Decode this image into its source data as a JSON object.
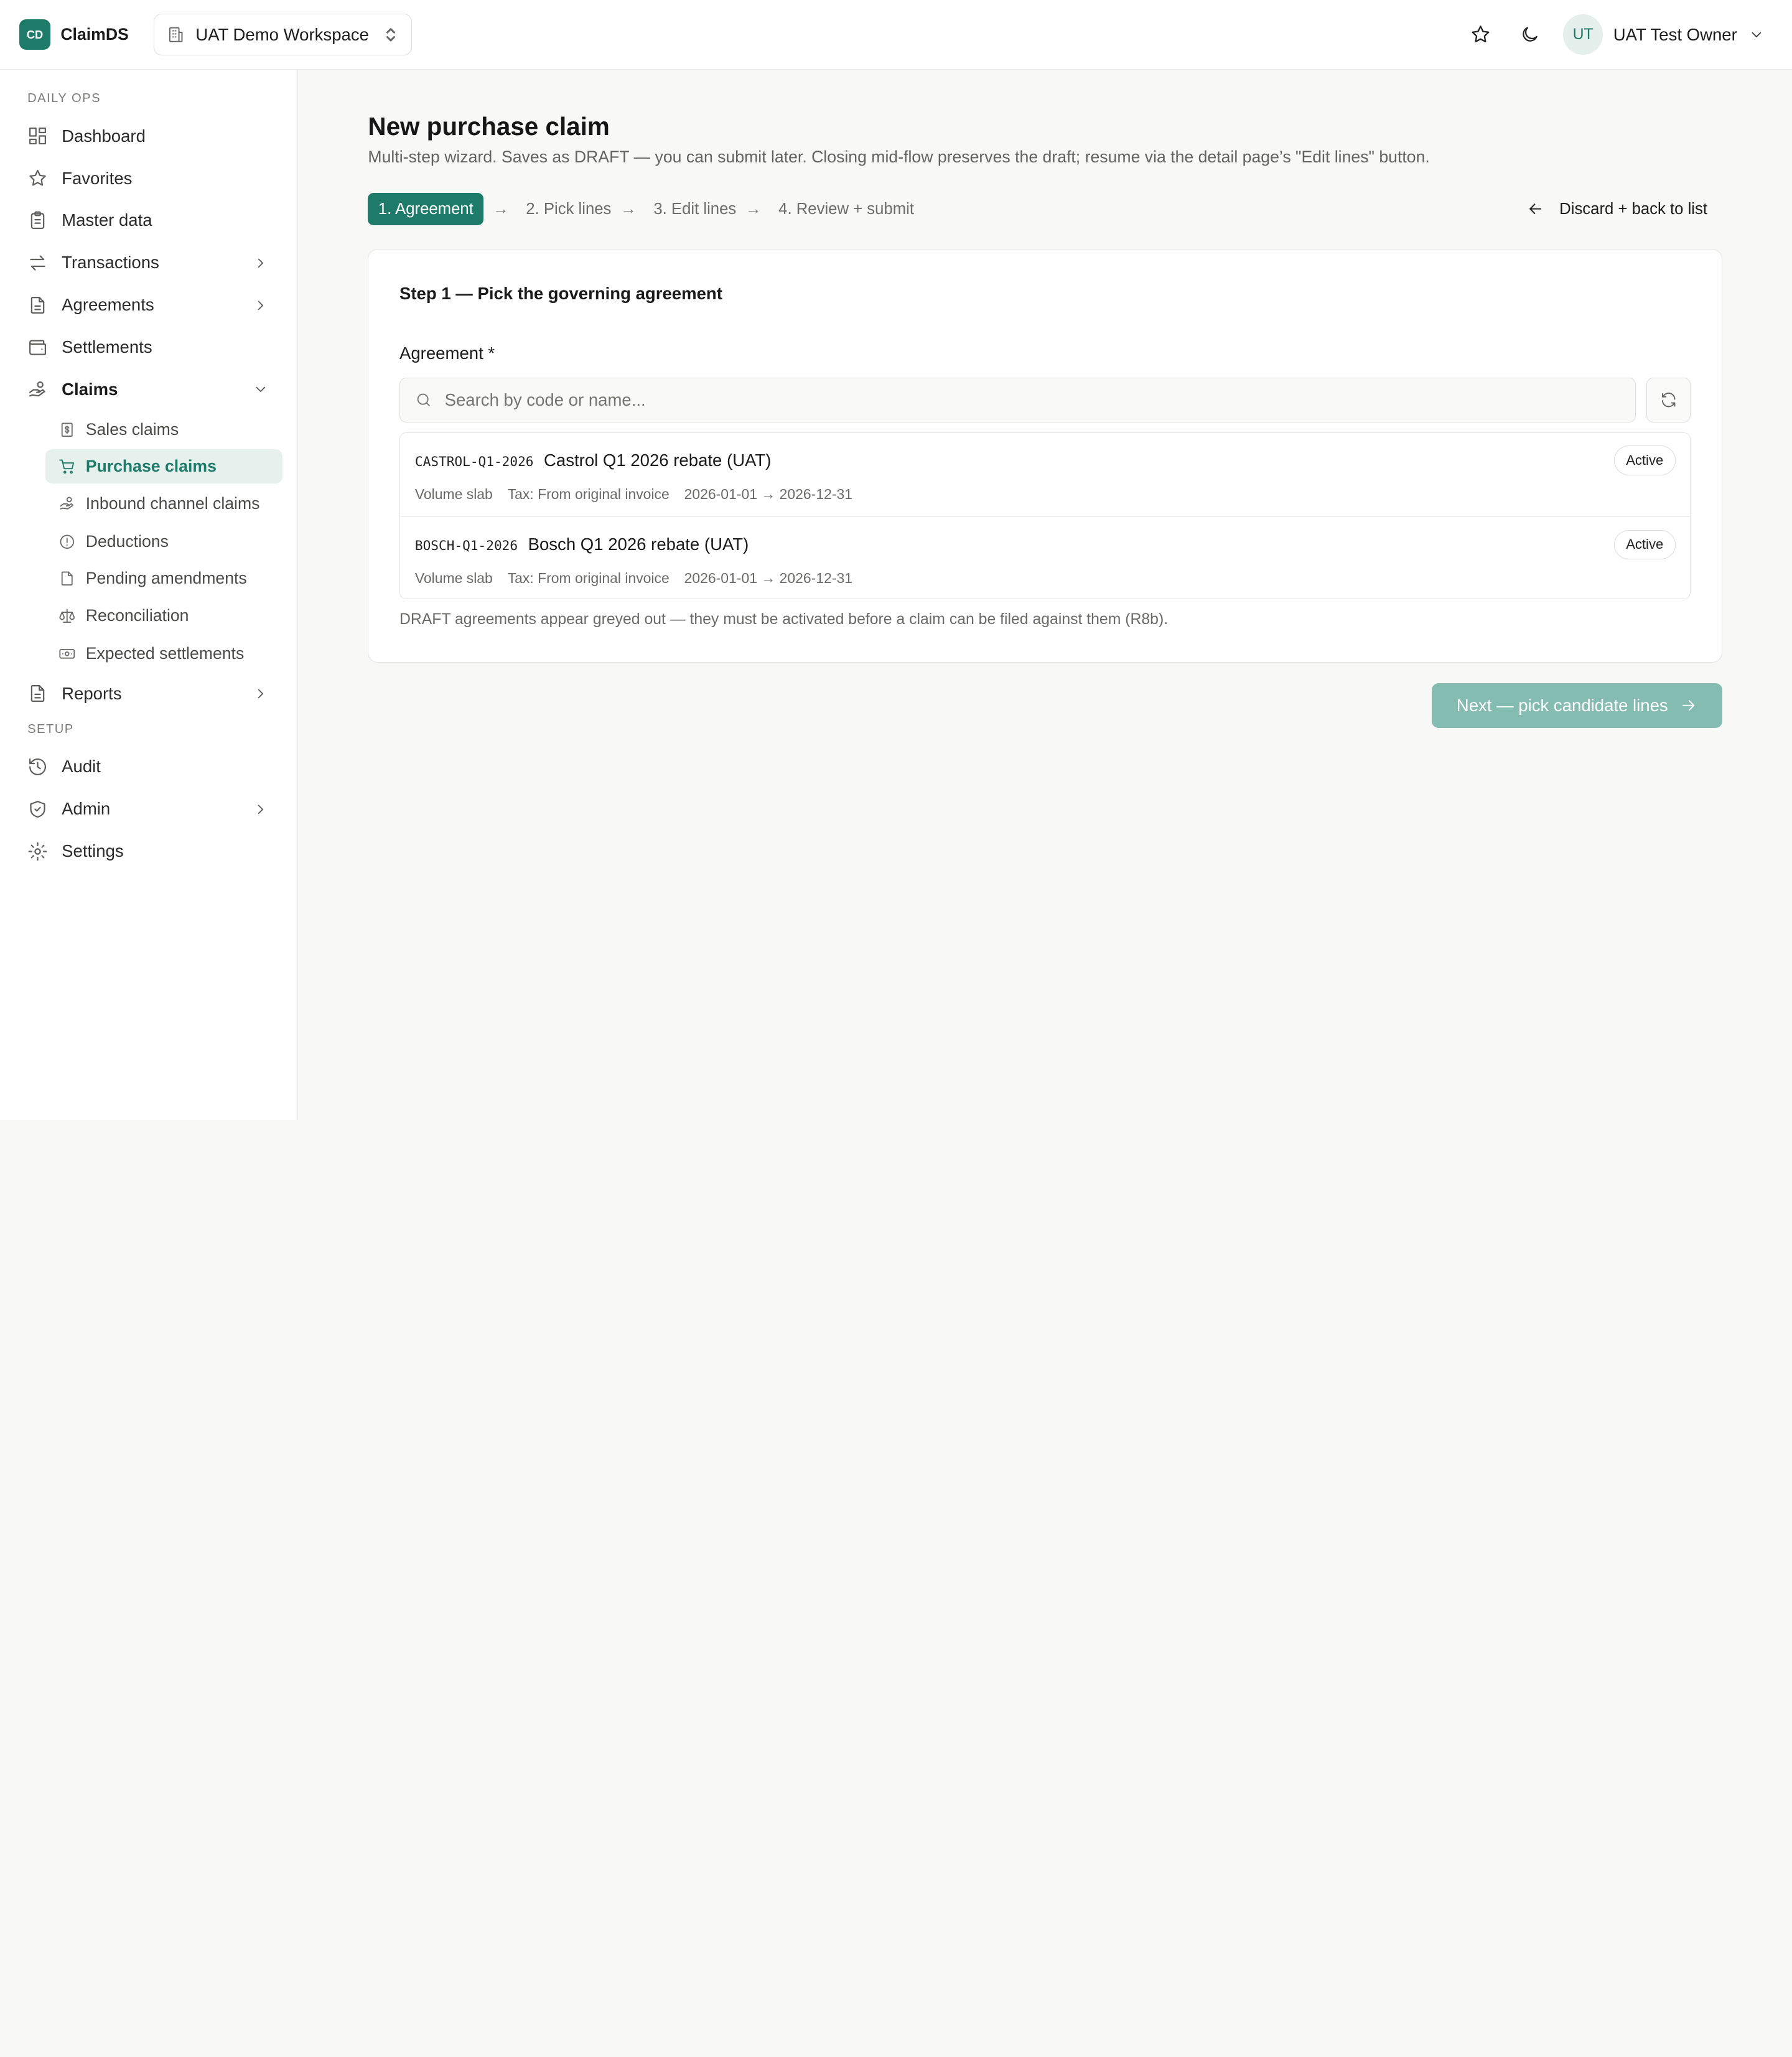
{
  "app": {
    "logo_initials": "CD",
    "name": "ClaimDS"
  },
  "workspace": {
    "name": "UAT Demo Workspace"
  },
  "user": {
    "initials": "UT",
    "name": "UAT Test Owner"
  },
  "sidebar": {
    "section_daily": "DAILY OPS",
    "section_setup": "SETUP",
    "items": {
      "dashboard": "Dashboard",
      "favorites": "Favorites",
      "master_data": "Master data",
      "transactions": "Transactions",
      "agreements": "Agreements",
      "settlements": "Settlements",
      "claims": "Claims",
      "reports": "Reports",
      "audit": "Audit",
      "admin": "Admin",
      "settings": "Settings"
    },
    "claims_sub": {
      "sales_claims": "Sales claims",
      "purchase_claims": "Purchase claims",
      "inbound_channel_claims": "Inbound channel claims",
      "deductions": "Deductions",
      "pending_amendments": "Pending amendments",
      "reconciliation": "Reconciliation",
      "expected_settlements": "Expected settlements"
    },
    "active_item": "Purchase claims"
  },
  "page": {
    "title": "New purchase claim",
    "subtitle": "Multi-step wizard. Saves as DRAFT — you can submit later. Closing mid-flow preserves the draft; resume via the detail page’s \"Edit lines\" button.",
    "discard_label": "Discard + back to list"
  },
  "wizard": {
    "steps": [
      "1. Agreement",
      "2. Pick lines",
      "3. Edit lines",
      "4. Review + submit"
    ],
    "arrow": "→",
    "current_step": 1
  },
  "step1": {
    "title": "Step 1 — Pick the governing agreement",
    "field_label": "Agreement *",
    "search_placeholder": "Search by code or name...",
    "search_value": "",
    "agreements": [
      {
        "code": "CASTROL-Q1-2026",
        "name": "Castrol Q1 2026 rebate (UAT)",
        "type": "Volume slab",
        "tax": "Tax: From original invoice",
        "period": "2026-01-01 → 2026-12-31",
        "status": "Active"
      },
      {
        "code": "BOSCH-Q1-2026",
        "name": "Bosch Q1 2026 rebate (UAT)",
        "type": "Volume slab",
        "tax": "Tax: From original invoice",
        "period": "2026-01-01 → 2026-12-31",
        "status": "Active"
      }
    ],
    "note": "DRAFT agreements appear greyed out — they must be activated before a claim can be filed against them (R8b)."
  },
  "next_button": {
    "label": "Next — pick candidate lines",
    "enabled": false
  },
  "colors": {
    "accent": "#1e7a69",
    "accent_light": "#e6f0ed",
    "next_disabled": "#84bcb1"
  }
}
